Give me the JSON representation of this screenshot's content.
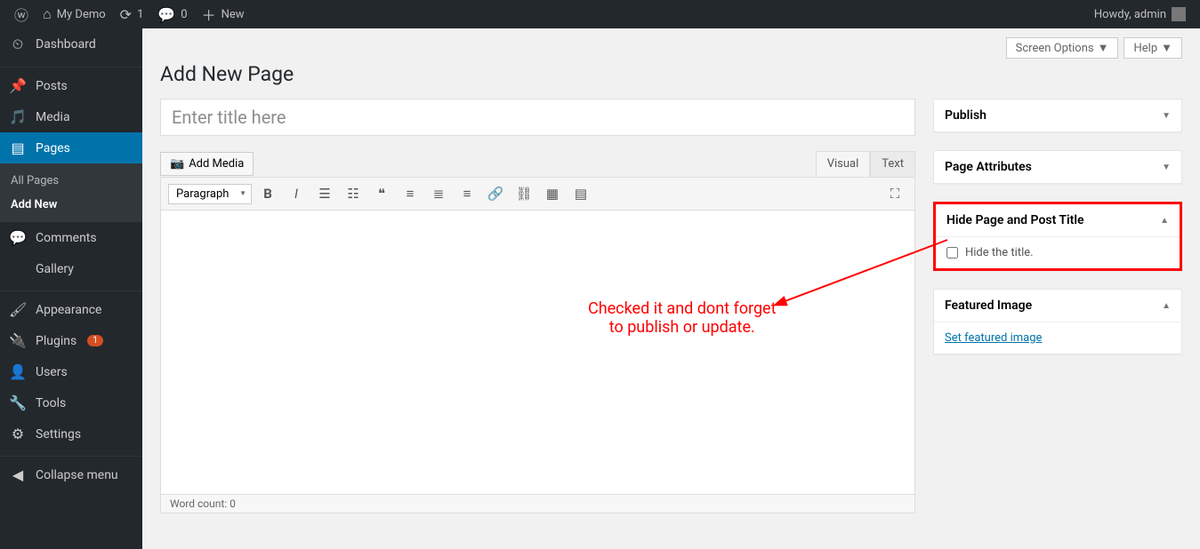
{
  "adminbar": {
    "site_name": "My Demo",
    "updates": "1",
    "comments": "0",
    "new_label": "New",
    "greeting": "Howdy, admin"
  },
  "sidebar": {
    "dashboard": "Dashboard",
    "posts": "Posts",
    "media": "Media",
    "pages": "Pages",
    "all_pages": "All Pages",
    "add_new": "Add New",
    "comments": "Comments",
    "gallery": "Gallery",
    "appearance": "Appearance",
    "plugins": "Plugins",
    "plugins_count": "1",
    "users": "Users",
    "tools": "Tools",
    "settings": "Settings",
    "collapse": "Collapse menu"
  },
  "top": {
    "screen_options": "Screen Options",
    "help": "Help"
  },
  "page_heading": "Add New Page",
  "title_placeholder": "Enter title here",
  "add_media": "Add Media",
  "tabs": {
    "visual": "Visual",
    "text": "Text"
  },
  "format_select": "Paragraph",
  "word_count": "Word count: 0",
  "annotation_line1": "Checked it and dont forget",
  "annotation_line2": "to publish or update.",
  "boxes": {
    "publish": "Publish",
    "page_attributes": "Page Attributes",
    "hide_title": "Hide Page and Post Title",
    "hide_title_checkbox": "Hide the title.",
    "featured_image": "Featured Image",
    "set_featured": "Set featured image"
  }
}
